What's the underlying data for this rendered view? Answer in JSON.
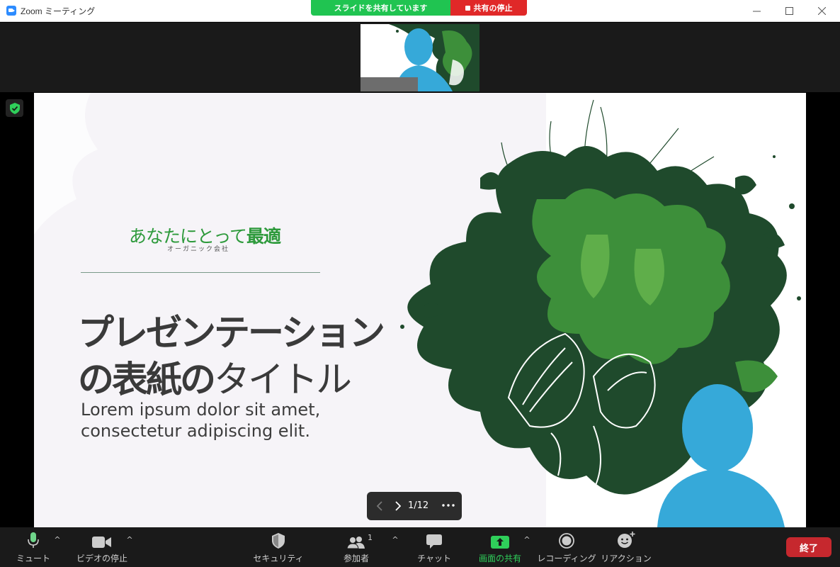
{
  "window": {
    "title": "Zoom ミーティング",
    "minimize_label": "—",
    "maximize_label": "☐",
    "close_label": "✕"
  },
  "share_banner": {
    "status": "スライドを共有しています",
    "stop_label": "共有の停止"
  },
  "slide": {
    "brand_main_regular": "あなたにとって",
    "brand_main_bold": "最適",
    "brand_sub": "オーガニック会社",
    "title_line1": "プレゼンテーション",
    "title_line2_bold": "の表紙の",
    "title_line2_light": "タイトル",
    "body_line1": "Lorem ipsum dolor sit amet,",
    "body_line2": "consectetur adipiscing elit.",
    "colors": {
      "brand": "#2e9a3c",
      "title": "#3a3a3a",
      "leaf_dark": "#1f4a2c",
      "leaf_light": "#3d8f3a",
      "avatar": "#36a9d9"
    }
  },
  "slide_nav": {
    "prev_icon": "chevron-left-icon",
    "next_icon": "chevron-right-icon",
    "page": "1/12",
    "more_icon": "more-horizontal-icon"
  },
  "toolbar": {
    "mute_label": "ミュート",
    "video_label": "ビデオの停止",
    "security_label": "セキュリティ",
    "participants_label": "参加者",
    "participants_count": "1",
    "chat_label": "チャット",
    "share_label": "画面の共有",
    "record_label": "レコーディング",
    "reaction_label": "リアクション",
    "end_label": "終了",
    "caret": "^",
    "colors": {
      "share_green": "#2fcf5a",
      "end_red": "#c6282e"
    }
  }
}
